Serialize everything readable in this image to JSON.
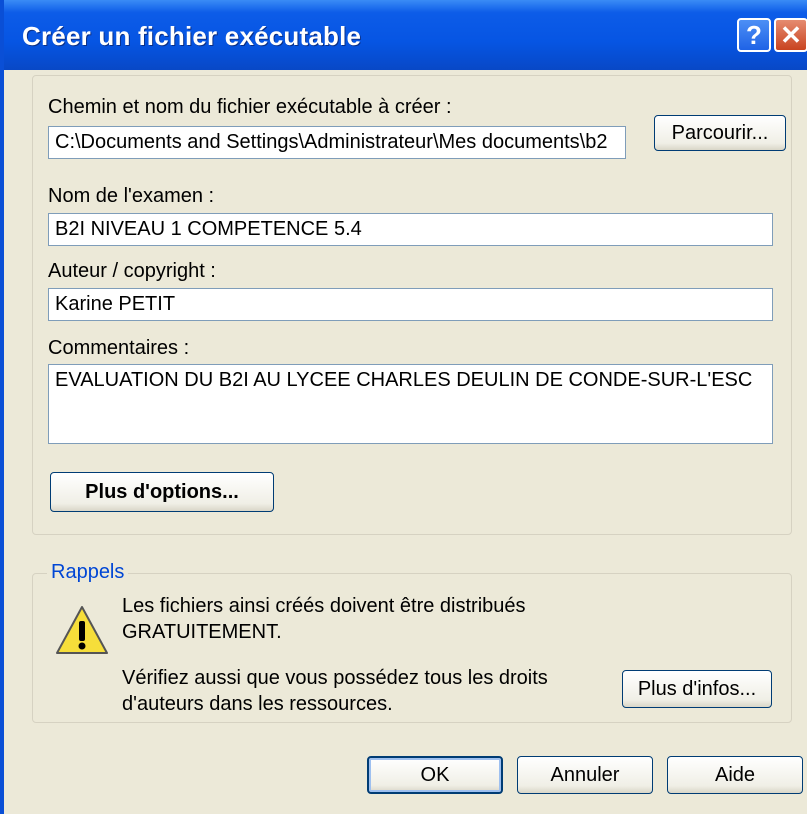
{
  "window": {
    "title": "Créer un fichier exécutable"
  },
  "titlebar": {
    "help_glyph": "?",
    "close_glyph": "✕"
  },
  "form": {
    "path_label": "Chemin et nom du fichier exécutable à créer :",
    "path_value": "C:\\Documents and Settings\\Administrateur\\Mes documents\\b2",
    "browse_label": "Parcourir...",
    "exam_label": "Nom de l'examen :",
    "exam_value": "B2I NIVEAU 1 COMPETENCE 5.4",
    "author_label": "Auteur / copyright :",
    "author_value": "Karine PETIT",
    "comments_label": "Commentaires :",
    "comments_value": "EVALUATION DU B2I AU LYCEE CHARLES DEULIN DE CONDE-SUR-L'ESC",
    "more_options_label": "Plus d'options..."
  },
  "reminders": {
    "title": "Rappels",
    "icon": "warning-icon",
    "message1_line1": "Les fichiers ainsi créés doivent être distribués",
    "message1_line2": "GRATUITEMENT.",
    "message2_line1": "Vérifiez aussi que vous possédez tous les droits",
    "message2_line2": "d'auteurs dans les ressources.",
    "more_info_label": "Plus d'infos..."
  },
  "footer": {
    "ok_label": "OK",
    "cancel_label": "Annuler",
    "help_label": "Aide"
  },
  "colors": {
    "titlebar": "#0655e3",
    "dialog_bg": "#ece9d8",
    "group_title": "#0046d5",
    "close_button": "#c94420"
  }
}
